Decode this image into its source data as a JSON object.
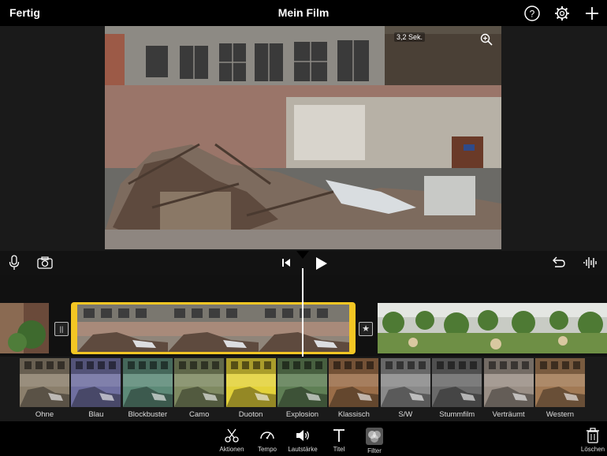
{
  "topbar": {
    "done_label": "Fertig",
    "title": "Mein Film"
  },
  "viewer": {
    "duration": "3,2 Sek."
  },
  "filters": [
    {
      "label": "Ohne",
      "tint": "#8b7f6c"
    },
    {
      "label": "Blau",
      "tint": "#6f6fa0"
    },
    {
      "label": "Blockbuster",
      "tint": "#5d8a78"
    },
    {
      "label": "Camo",
      "tint": "#7f8a62"
    },
    {
      "label": "Duoton",
      "tint": "#e3d23a"
    },
    {
      "label": "Explosion",
      "tint": "#5f7f55"
    },
    {
      "label": "Klassisch",
      "tint": "#9a6d48"
    },
    {
      "label": "S/W",
      "tint": "#8a8a8a"
    },
    {
      "label": "Stummfilm",
      "tint": "#6a6a6a"
    },
    {
      "label": "Verträumt",
      "tint": "#9a8f86"
    },
    {
      "label": "Western",
      "tint": "#a27a55"
    }
  ],
  "toolbar": {
    "actions_label": "Aktionen",
    "speed_label": "Tempo",
    "volume_label": "Lautstärke",
    "titles_label": "Titel",
    "filter_label": "Filter",
    "delete_label": "Löschen"
  },
  "colors": {
    "accent": "#f3c623",
    "background": "#000000"
  }
}
